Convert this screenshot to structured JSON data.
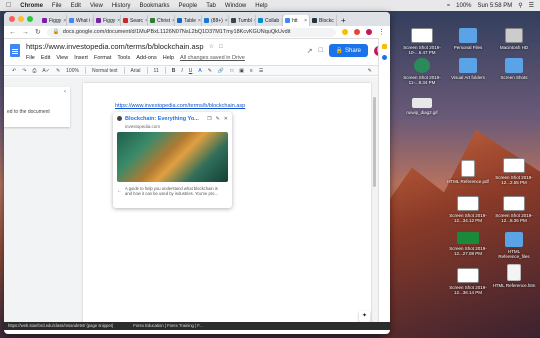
{
  "menubar": {
    "app": "Chrome",
    "items": [
      "File",
      "Edit",
      "View",
      "History",
      "Bookmarks",
      "People",
      "Tab",
      "Window",
      "Help"
    ],
    "clock": "Sun 5:58 PM",
    "battery": "100%"
  },
  "browser": {
    "tabs": [
      {
        "label": "Figgy",
        "color": "#7b1fa2"
      },
      {
        "label": "What i",
        "color": "#4285f4"
      },
      {
        "label": "Figgy",
        "color": "#7b1fa2"
      },
      {
        "label": "Searc",
        "color": "#c62828"
      },
      {
        "label": "Christ",
        "color": "#2e7d32"
      },
      {
        "label": "Table",
        "color": "#1565c0"
      },
      {
        "label": "(88+)",
        "color": "#1976d2"
      },
      {
        "label": "Tumbl",
        "color": "#37474f"
      },
      {
        "label": "Collab",
        "color": "#0288d1"
      },
      {
        "label": "htt",
        "color": "#4285f4",
        "active": true
      },
      {
        "label": "Blockc",
        "color": "#263238"
      }
    ],
    "new_tab": "+",
    "url": "docs.google.com/document/d/1MuPBxL1126N07NsL2bQ1D37M1Tmy18KcvKGUNquQkUvdit"
  },
  "doc": {
    "title": "https://www.investopedia.com/terms/b/blockchain.asp",
    "menu": [
      "File",
      "Edit",
      "View",
      "Insert",
      "Format",
      "Tools",
      "Add-ons",
      "Help"
    ],
    "saved_status": "All changes saved in Drive",
    "share_label": "Share",
    "avatar_letter": "B",
    "toolbar": {
      "zoom": "100%",
      "style": "Normal text",
      "font": "Arial",
      "size": "11"
    },
    "outline_text": "ed to the document",
    "link_text": "https://www.investopedia.com/terms/b/blockchain.asp",
    "card": {
      "title": "Blockchain: Everything Yo...",
      "site": "investopedia.com",
      "description": "A guide to help you understand what blockchain is and how it can be used by industries. You've pro..."
    }
  },
  "statusbar": {
    "url": "https://web.stanford.edu/class/msande94/ (page snippet)",
    "right": "Forex Education | Forex Training | F..."
  },
  "desktop": [
    {
      "label": "Screen Shot 2019-10-...6.47 PM",
      "kind": "shot"
    },
    {
      "label": "Personal Files",
      "kind": "folder"
    },
    {
      "label": "Macintosh HD",
      "kind": "drive"
    },
    {
      "label": "Screen Shot 2019-11-...8.34 PM",
      "kind": "circle"
    },
    {
      "label": "Visual Art folders",
      "kind": "folder"
    },
    {
      "label": "Screen Shots",
      "kind": "folder"
    },
    {
      "label": "ruiwip_diag2.gif",
      "kind": "blank"
    },
    {
      "label": "HTML Reference.pdf",
      "kind": "pdf"
    },
    {
      "label": "Screen Shot 2019-12...2.55 PM",
      "kind": "shot"
    },
    {
      "label": "Screen Shot 2019-12...34.12 PM",
      "kind": "shot"
    },
    {
      "label": "Screen Shot 2019-12...8.36 PM",
      "kind": "shot"
    },
    {
      "label": "Screen Shot 2019-12...27.08 PM",
      "kind": "green"
    },
    {
      "label": "HTML Reference_files",
      "kind": "folder"
    },
    {
      "label": "Screen Shot 2019-12...38.14 PM",
      "kind": "shot"
    },
    {
      "label": "HTML Reference.htm",
      "kind": "doc"
    }
  ]
}
